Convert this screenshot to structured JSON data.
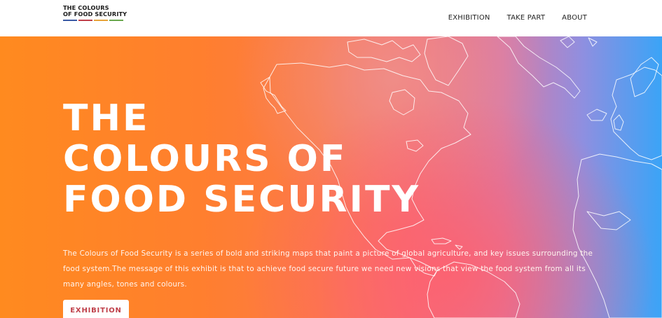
{
  "logo": {
    "line1": "THE COLOURS",
    "line2": "OF FOOD SECURITY",
    "bar_colors": [
      "#3b5ba5",
      "#c0404a",
      "#e7a43a",
      "#6aa84f"
    ]
  },
  "nav": {
    "items": [
      {
        "label": "EXHIBITION"
      },
      {
        "label": "TAKE PART"
      },
      {
        "label": "ABOUT"
      }
    ]
  },
  "hero": {
    "title_lines": [
      "THE",
      "COLOURS OF",
      "FOOD SECURITY"
    ],
    "description": "The Colours of Food Security is a series of bold and striking maps that paint a picture of global agriculture, and key issues surrounding the food system.The message of this exhibit is that to achieve food secure future we need new visions that view the food system from all its many angles, tones and colours.",
    "cta_label": "EXHIBITION",
    "gradient_colors": [
      "#ff8a1f",
      "#f46f74",
      "#3aa4f7"
    ]
  }
}
